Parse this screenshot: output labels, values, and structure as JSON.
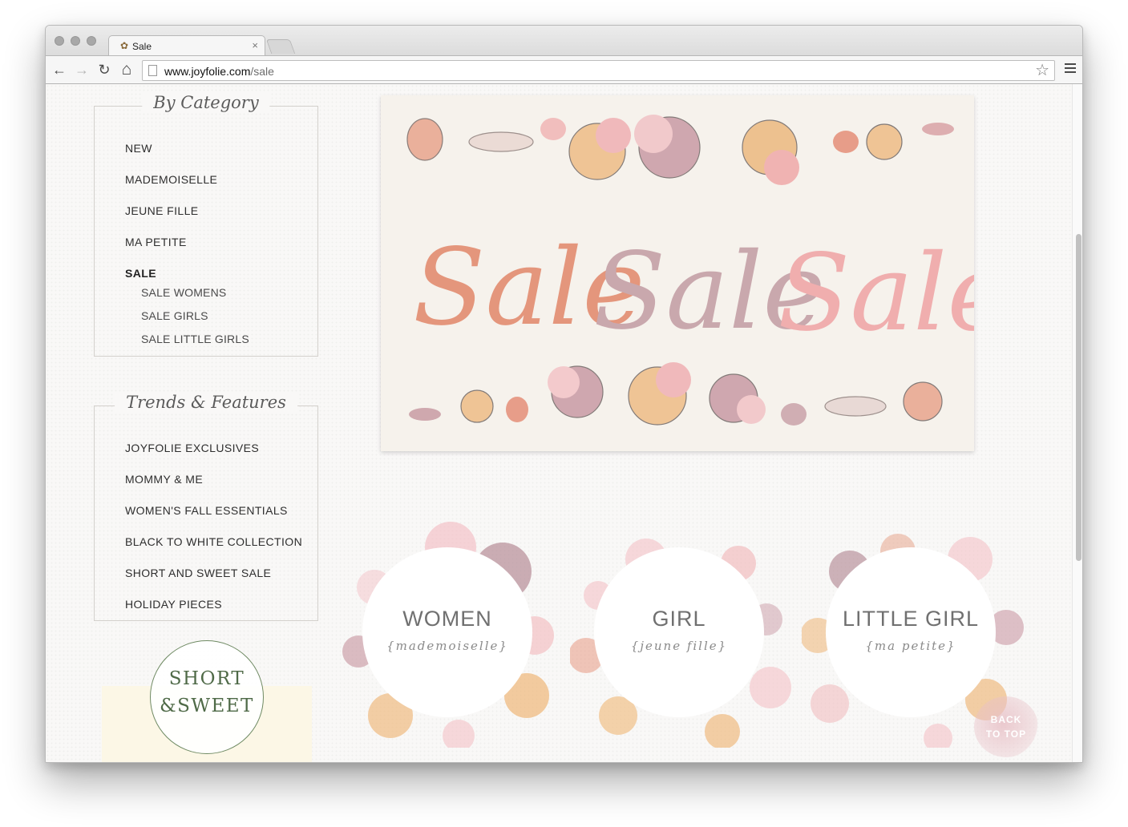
{
  "browser": {
    "tab_title": "Sale",
    "tab_close": "×",
    "url_host": "www.joyfolie.com",
    "url_path": "/sale",
    "back": "←",
    "forward": "→",
    "reload": "↻",
    "home": "⌂",
    "star": "☆"
  },
  "sidebar": {
    "category": {
      "title": "By Category",
      "items": [
        "NEW",
        "MADEMOISELLE",
        "JEUNE FILLE",
        "MA PETITE",
        "SALE"
      ],
      "subitems": [
        "SALE WOMENS",
        "SALE GIRLS",
        "SALE LITTLE GIRLS"
      ]
    },
    "trends": {
      "title": "Trends & Features",
      "items": [
        "JOYFOLIE EXCLUSIVES",
        "MOMMY & ME",
        "WOMEN'S FALL ESSENTIALS",
        "BLACK TO WHITE COLLECTION",
        "SHORT AND SWEET SALE",
        "HOLIDAY PIECES"
      ]
    },
    "promo": {
      "line1": "SHORT",
      "line2": "&SWEET"
    }
  },
  "banner": {
    "word1": "Sale",
    "word2": "Sale",
    "word3": "Sale",
    "colors": [
      "#e4967c",
      "#c9a8ad",
      "#f0aeae"
    ]
  },
  "circles": [
    {
      "title": "WOMEN",
      "subtitle": "{mademoiselle}"
    },
    {
      "title": "GIRL",
      "subtitle": "{jeune fille}"
    },
    {
      "title": "LITTLE GIRL",
      "subtitle": "{ma petite}"
    }
  ],
  "back_to_top": {
    "line1": "BACK",
    "line2": "TO TOP"
  }
}
